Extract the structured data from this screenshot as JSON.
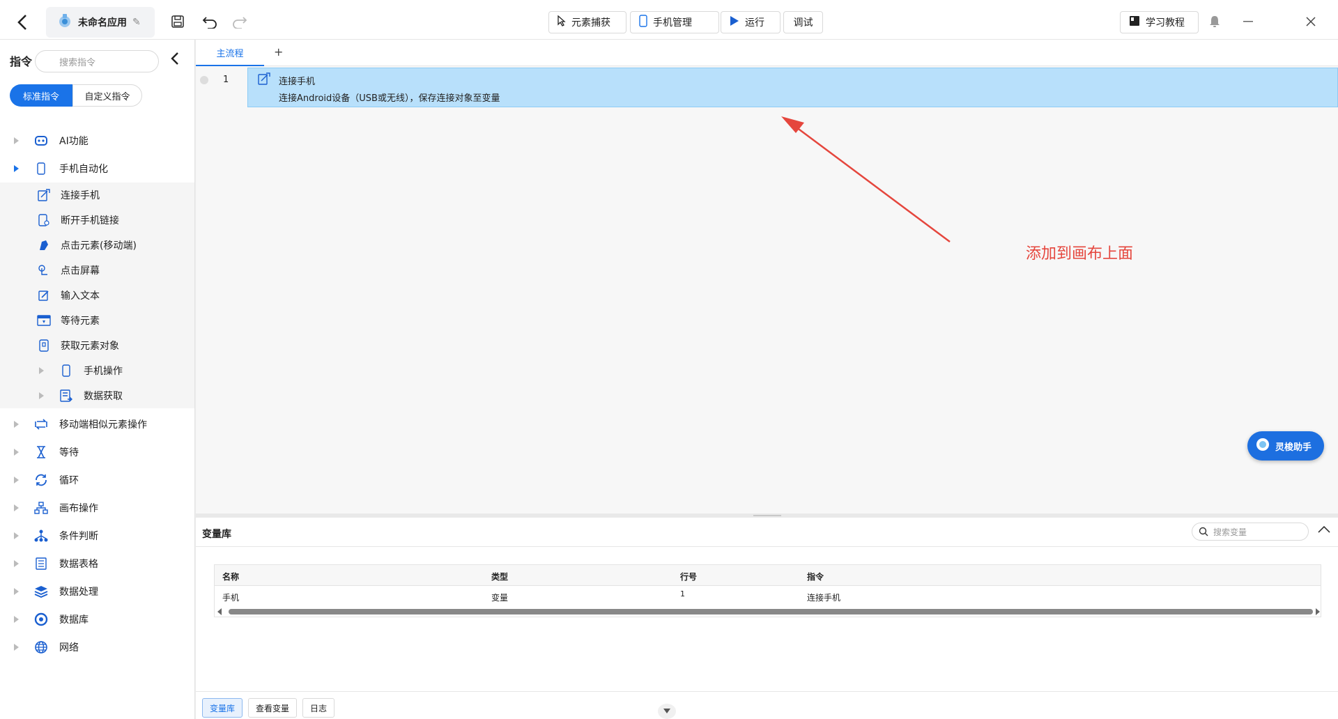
{
  "titlebar": {
    "app_name": "未命名应用",
    "element_capture": "元素捕获",
    "phone_manage": "手机管理",
    "run": "运行",
    "debug": "调试",
    "tutorial": "学习教程"
  },
  "sidebar": {
    "title": "指令",
    "search_placeholder": "搜索指令",
    "tab_standard": "标准指令",
    "tab_custom": "自定义指令",
    "items": [
      {
        "label": "AI功能",
        "icon": "robot-icon"
      },
      {
        "label": "手机自动化",
        "icon": "phone-icon"
      },
      {
        "label": "连接手机",
        "icon": "connect-phone-icon"
      },
      {
        "label": "断开手机链接",
        "icon": "disconnect-phone-icon"
      },
      {
        "label": "点击元素(移动端)",
        "icon": "tap-element-icon"
      },
      {
        "label": "点击屏幕",
        "icon": "tap-screen-icon"
      },
      {
        "label": "输入文本",
        "icon": "input-text-icon"
      },
      {
        "label": "等待元素",
        "icon": "wait-element-icon"
      },
      {
        "label": "获取元素对象",
        "icon": "get-element-icon"
      },
      {
        "label": "手机操作",
        "icon": "phone-operation-icon"
      },
      {
        "label": "数据获取",
        "icon": "data-fetch-icon"
      },
      {
        "label": "移动端相似元素操作",
        "icon": "similar-elements-icon"
      },
      {
        "label": "等待",
        "icon": "hourglass-icon"
      },
      {
        "label": "循环",
        "icon": "loop-icon"
      },
      {
        "label": "画布操作",
        "icon": "canvas-icon"
      },
      {
        "label": "条件判断",
        "icon": "branch-icon"
      },
      {
        "label": "数据表格",
        "icon": "table-icon"
      },
      {
        "label": "数据处理",
        "icon": "layers-icon"
      },
      {
        "label": "数据库",
        "icon": "database-icon"
      },
      {
        "label": "网络",
        "icon": "globe-icon"
      }
    ]
  },
  "canvas": {
    "tab_main": "主流程",
    "tab_add": "+",
    "line_no": "1",
    "cmd_title": "连接手机",
    "cmd_desc": "连接Android设备（USB或无线），保存连接对象至变量",
    "annotation": "添加到画布上面",
    "assistant": "灵梭助手"
  },
  "varlib": {
    "title": "变量库",
    "search_placeholder": "搜索变量",
    "columns": [
      "名称",
      "类型",
      "行号",
      "指令"
    ],
    "row": [
      "手机",
      "变量",
      "1",
      "连接手机"
    ],
    "bottom_tabs": [
      "变量库",
      "查看变量",
      "日志"
    ]
  },
  "colors": {
    "accent": "#1a73e8",
    "selected_row": "#b8e0fb",
    "annotation": "#e5463d"
  }
}
